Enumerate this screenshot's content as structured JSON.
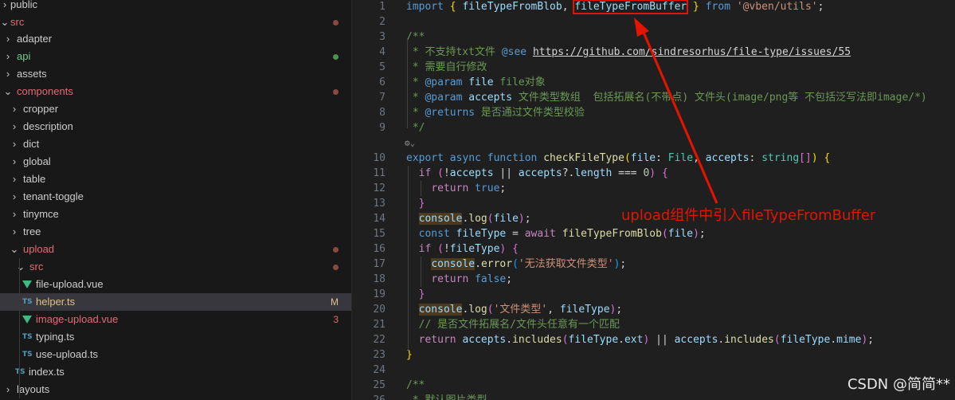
{
  "explorer": {
    "items": [
      {
        "label": "public",
        "chevron": "›",
        "color": "#cccccc",
        "status": "none"
      },
      {
        "label": "src",
        "chevron": "⌄",
        "color": "#e06c75",
        "status": "dot"
      },
      {
        "label": "adapter",
        "chevron": "›",
        "color": "#cccccc",
        "status": "none"
      },
      {
        "label": "api",
        "chevron": "›",
        "color": "#73c991",
        "status": "dot"
      },
      {
        "label": "assets",
        "chevron": "›",
        "color": "#cccccc",
        "status": "none"
      },
      {
        "label": "components",
        "chevron": "⌄",
        "color": "#e06c75",
        "status": "dot"
      },
      {
        "label": "cropper",
        "chevron": "›",
        "color": "#cccccc",
        "status": "none"
      },
      {
        "label": "description",
        "chevron": "›",
        "color": "#cccccc",
        "status": "none"
      },
      {
        "label": "dict",
        "chevron": "›",
        "color": "#cccccc",
        "status": "none"
      },
      {
        "label": "global",
        "chevron": "›",
        "color": "#cccccc",
        "status": "none"
      },
      {
        "label": "table",
        "chevron": "›",
        "color": "#cccccc",
        "status": "none"
      },
      {
        "label": "tenant-toggle",
        "chevron": "›",
        "color": "#cccccc",
        "status": "none"
      },
      {
        "label": "tinymce",
        "chevron": "›",
        "color": "#cccccc",
        "status": "none"
      },
      {
        "label": "tree",
        "chevron": "›",
        "color": "#cccccc",
        "status": "none"
      },
      {
        "label": "upload",
        "chevron": "⌄",
        "color": "#e06c75",
        "status": "dot"
      },
      {
        "label": "src",
        "chevron": "⌄",
        "color": "#e06c75",
        "status": "dot"
      },
      {
        "label": "file-upload.vue",
        "icon": "vue-icon",
        "color": "#cccccc",
        "status": "none"
      },
      {
        "label": "helper.ts",
        "icon": "ts-icon",
        "icon_text": "TS",
        "color": "#e2c08d",
        "status": "badge",
        "badge": "M",
        "badge_color": "#e2c08d"
      },
      {
        "label": "image-upload.vue",
        "icon": "vue-icon",
        "color": "#e06c75",
        "status": "badge",
        "badge": "3",
        "badge_color": "#e06c75"
      },
      {
        "label": "typing.ts",
        "icon": "ts-icon",
        "icon_text": "TS",
        "color": "#cccccc",
        "status": "none"
      },
      {
        "label": "use-upload.ts",
        "icon": "ts-icon",
        "icon_text": "TS",
        "color": "#cccccc",
        "status": "none"
      },
      {
        "label": "index.ts",
        "icon": "ts-icon",
        "icon_text": "TS",
        "color": "#cccccc",
        "status": "none"
      },
      {
        "label": "layouts",
        "chevron": "›",
        "color": "#cccccc",
        "status": "none"
      }
    ]
  },
  "editor": {
    "lines": [
      {
        "n": "1",
        "segments": [
          [
            "kw",
            "import "
          ],
          [
            "br1",
            "{ "
          ],
          [
            "var",
            "fileTypeFromBlob"
          ],
          [
            "pun",
            ", "
          ],
          [
            "var boxed",
            "fileTypeFromBuffer"
          ],
          [
            "br1",
            " }"
          ],
          [
            "kw",
            " from "
          ],
          [
            "str",
            "'@vben/utils'"
          ],
          [
            "pun",
            ";"
          ]
        ]
      },
      {
        "n": "2",
        "segments": []
      },
      {
        "n": "3",
        "segments": [
          [
            "cm",
            "/**"
          ]
        ]
      },
      {
        "n": "4",
        "segments": [
          [
            "cm",
            " * 不支持txt文件 "
          ],
          [
            "cmtag",
            "@see"
          ],
          [
            "cm",
            " "
          ],
          [
            "link",
            "https://github.com/sindresorhus/file-type/issues/55"
          ]
        ]
      },
      {
        "n": "5",
        "segments": [
          [
            "cm",
            " * 需要自行修改"
          ]
        ]
      },
      {
        "n": "6",
        "segments": [
          [
            "cm",
            " * "
          ],
          [
            "cmtag",
            "@param"
          ],
          [
            "cm",
            " "
          ],
          [
            "cmpar",
            "file"
          ],
          [
            "cm",
            " file对象"
          ]
        ]
      },
      {
        "n": "7",
        "segments": [
          [
            "cm",
            " * "
          ],
          [
            "cmtag",
            "@param"
          ],
          [
            "cm",
            " "
          ],
          [
            "cmpar",
            "accepts"
          ],
          [
            "cm",
            " 文件类型数组  包括拓展名(不带点) 文件头(image/png等 不包括泛写法即image/*)"
          ]
        ]
      },
      {
        "n": "8",
        "segments": [
          [
            "cm",
            " * "
          ],
          [
            "cmtag",
            "@returns"
          ],
          [
            "cm",
            " 是否通过文件类型校验"
          ]
        ]
      },
      {
        "n": "9",
        "segments": [
          [
            "cm",
            " */"
          ]
        ]
      },
      {
        "n": "",
        "segments": []
      },
      {
        "n": "10",
        "segments": [
          [
            "kw",
            "export "
          ],
          [
            "kw",
            "async "
          ],
          [
            "kw",
            "function "
          ],
          [
            "fn",
            "checkFileType"
          ],
          [
            "br1",
            "("
          ],
          [
            "var",
            "file"
          ],
          [
            "pun",
            ": "
          ],
          [
            "type",
            "File"
          ],
          [
            "pun",
            ", "
          ],
          [
            "var",
            "accepts"
          ],
          [
            "pun",
            ": "
          ],
          [
            "type",
            "string"
          ],
          [
            "br2",
            "[]"
          ],
          [
            "br1",
            ")"
          ],
          [
            "pun",
            " "
          ],
          [
            "br1",
            "{"
          ]
        ]
      },
      {
        "n": "11",
        "segments": [
          [
            "pun",
            "  "
          ],
          [
            "ctl",
            "if "
          ],
          [
            "br2",
            "("
          ],
          [
            "pun",
            "!"
          ],
          [
            "var",
            "accepts"
          ],
          [
            "pun",
            " || "
          ],
          [
            "var",
            "accepts"
          ],
          [
            "pun",
            "?."
          ],
          [
            "var",
            "length"
          ],
          [
            "pun",
            " === "
          ],
          [
            "num",
            "0"
          ],
          [
            "br2",
            ")"
          ],
          [
            "pun",
            " "
          ],
          [
            "br2",
            "{"
          ]
        ]
      },
      {
        "n": "12",
        "segments": [
          [
            "pun",
            "    "
          ],
          [
            "ctl",
            "return "
          ],
          [
            "kw",
            "true"
          ],
          [
            "pun",
            ";"
          ]
        ]
      },
      {
        "n": "13",
        "segments": [
          [
            "pun",
            "  "
          ],
          [
            "br2",
            "}"
          ]
        ]
      },
      {
        "n": "14",
        "segments": [
          [
            "pun",
            "  "
          ],
          [
            "var hl",
            "console"
          ],
          [
            "pun",
            "."
          ],
          [
            "fn",
            "log"
          ],
          [
            "br2",
            "("
          ],
          [
            "var",
            "file"
          ],
          [
            "br2",
            ")"
          ],
          [
            "pun",
            ";"
          ]
        ]
      },
      {
        "n": "15",
        "segments": [
          [
            "pun",
            "  "
          ],
          [
            "kw",
            "const "
          ],
          [
            "var",
            "fileType"
          ],
          [
            "pun",
            " = "
          ],
          [
            "ctl",
            "await "
          ],
          [
            "fn",
            "fileTypeFromBlob"
          ],
          [
            "br2",
            "("
          ],
          [
            "var",
            "file"
          ],
          [
            "br2",
            ")"
          ],
          [
            "pun",
            ";"
          ]
        ]
      },
      {
        "n": "16",
        "segments": [
          [
            "pun",
            "  "
          ],
          [
            "ctl",
            "if "
          ],
          [
            "br2",
            "("
          ],
          [
            "pun",
            "!"
          ],
          [
            "var",
            "fileType"
          ],
          [
            "br2",
            ")"
          ],
          [
            "pun",
            " "
          ],
          [
            "br2",
            "{"
          ]
        ]
      },
      {
        "n": "17",
        "segments": [
          [
            "pun",
            "    "
          ],
          [
            "var hl",
            "console"
          ],
          [
            "pun",
            "."
          ],
          [
            "fn",
            "error"
          ],
          [
            "br3",
            "("
          ],
          [
            "str",
            "'无法获取文件类型'"
          ],
          [
            "br3",
            ")"
          ],
          [
            "pun",
            ";"
          ]
        ]
      },
      {
        "n": "18",
        "segments": [
          [
            "pun",
            "    "
          ],
          [
            "ctl",
            "return "
          ],
          [
            "kw",
            "false"
          ],
          [
            "pun",
            ";"
          ]
        ]
      },
      {
        "n": "19",
        "segments": [
          [
            "pun",
            "  "
          ],
          [
            "br2",
            "}"
          ]
        ]
      },
      {
        "n": "20",
        "segments": [
          [
            "pun",
            "  "
          ],
          [
            "var hl",
            "console"
          ],
          [
            "pun",
            "."
          ],
          [
            "fn",
            "log"
          ],
          [
            "br2",
            "("
          ],
          [
            "str",
            "'文件类型'"
          ],
          [
            "pun",
            ", "
          ],
          [
            "var",
            "fileType"
          ],
          [
            "br2",
            ")"
          ],
          [
            "pun",
            ";"
          ]
        ]
      },
      {
        "n": "21",
        "segments": [
          [
            "pun",
            "  "
          ],
          [
            "cm",
            "// 是否文件拓展名/文件头任意有一个匹配"
          ]
        ]
      },
      {
        "n": "22",
        "segments": [
          [
            "pun",
            "  "
          ],
          [
            "ctl",
            "return "
          ],
          [
            "var",
            "accepts"
          ],
          [
            "pun",
            "."
          ],
          [
            "fn",
            "includes"
          ],
          [
            "br2",
            "("
          ],
          [
            "var",
            "fileType"
          ],
          [
            "pun",
            "."
          ],
          [
            "var",
            "ext"
          ],
          [
            "br2",
            ")"
          ],
          [
            "pun",
            " || "
          ],
          [
            "var",
            "accepts"
          ],
          [
            "pun",
            "."
          ],
          [
            "fn",
            "includes"
          ],
          [
            "br2",
            "("
          ],
          [
            "var",
            "fileType"
          ],
          [
            "pun",
            "."
          ],
          [
            "var",
            "mime"
          ],
          [
            "br2",
            ")"
          ],
          [
            "pun",
            ";"
          ]
        ]
      },
      {
        "n": "23",
        "segments": [
          [
            "br1",
            "}"
          ]
        ]
      },
      {
        "n": "24",
        "segments": []
      },
      {
        "n": "25",
        "segments": [
          [
            "cm",
            "/**"
          ]
        ]
      },
      {
        "n": "26",
        "segments": [
          [
            "cm",
            " * 默认图片类型"
          ]
        ]
      }
    ]
  },
  "annotation": {
    "text": "upload组件中引入fileTypeFromBuffer",
    "color": "#e51400"
  },
  "watermark": {
    "text": "CSDN @简简**"
  }
}
